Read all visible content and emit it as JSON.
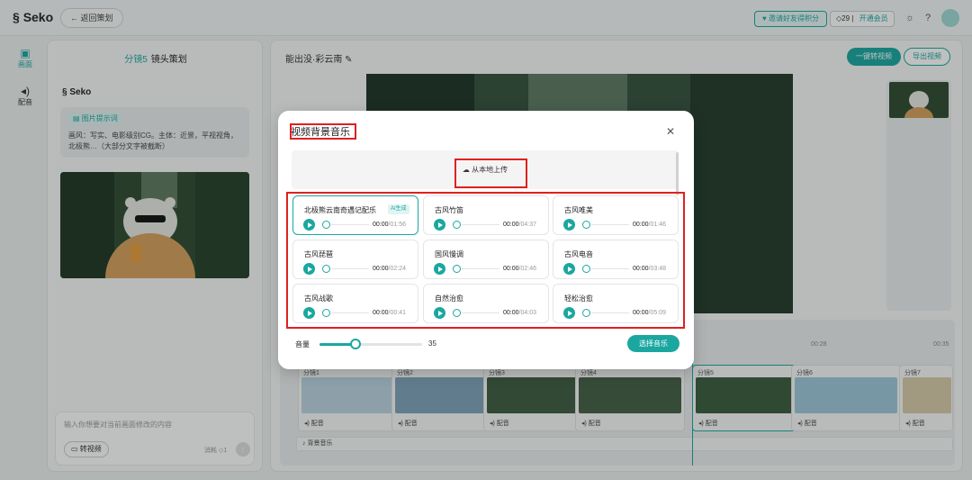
{
  "app": {
    "logo": "Seko",
    "back_label": "返回策划",
    "invite_label": "邀请好友得积分",
    "credits": "29",
    "vip_label": "开通会员",
    "accent": "#1aa7a0"
  },
  "rail": [
    {
      "label": "画面",
      "icon": "image-icon"
    },
    {
      "label": "配音",
      "icon": "speaker-icon"
    }
  ],
  "left_panel": {
    "title_highlight": "分镜5",
    "title": "镜头策划",
    "brand": "Seko",
    "prompt_tag": "图片提示词",
    "prompt_text": "画风：写实、电影级别CG。主体：近景，平视视角，北极熊…（大部分文字被截断）",
    "input_placeholder": "输入你想要对当前画面修改的内容",
    "to_video_label": "转视频",
    "consume_label": "消耗 ◇1"
  },
  "main": {
    "title": "能出没·彩云南",
    "one_click_label": "一键转视频",
    "export_label": "导出视频",
    "ruler_times": [
      "00:28",
      "00:35"
    ],
    "shots": [
      {
        "title": "分镜1",
        "dub": "配音"
      },
      {
        "title": "分镜2",
        "dub": "配音"
      },
      {
        "title": "分镜3",
        "dub": "配音"
      },
      {
        "title": "分镜4",
        "dub": "配音"
      },
      {
        "title": "分镜5",
        "dub": "配音"
      },
      {
        "title": "分镜6",
        "dub": "配音"
      },
      {
        "title": "分镜7",
        "dub": "配音"
      }
    ],
    "bgm_label": "背景音乐"
  },
  "modal": {
    "title": "视频背景音乐",
    "upload_label": "从本地上传",
    "tracks": [
      {
        "name": "北极熊云南奇遇记配乐",
        "badge": "AI生成",
        "current": "00:00",
        "total": "/01:56",
        "selected": true
      },
      {
        "name": "古风竹笛",
        "current": "00:00",
        "total": "/04:37"
      },
      {
        "name": "古风唯美",
        "current": "00:00",
        "total": "/01:46"
      },
      {
        "name": "古风琵琶",
        "current": "00:00",
        "total": "/02:24"
      },
      {
        "name": "国风慢调",
        "current": "00:00",
        "total": "/02:46"
      },
      {
        "name": "古风电音",
        "current": "00:00",
        "total": "/03:48"
      },
      {
        "name": "古风战歌",
        "current": "00:00",
        "total": "/00:41"
      },
      {
        "name": "自然治愈",
        "current": "00:00",
        "total": "/04:03"
      },
      {
        "name": "轻松治愈",
        "current": "00:00",
        "total": "/05:09"
      }
    ],
    "volume_label": "音量",
    "volume": 35,
    "volume_max": 100,
    "choose_label": "选择音乐"
  }
}
